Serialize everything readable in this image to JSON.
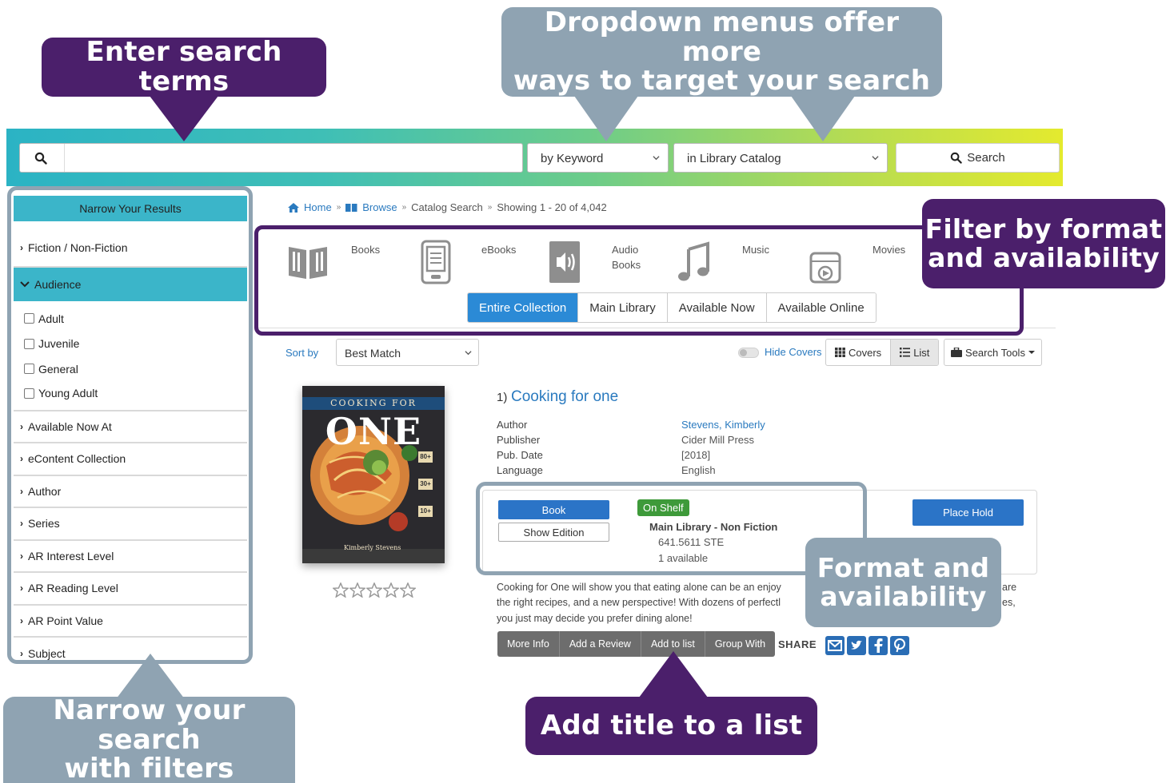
{
  "callouts": {
    "search_terms": "Enter search terms",
    "dropdown_line1": "Dropdown menus offer more",
    "dropdown_line2": "ways to target your search",
    "filter_line1": "Filter by format",
    "filter_line2": "and availability",
    "format_line1": "Format and",
    "format_line2": "availability",
    "narrow_line1": "Narrow your search",
    "narrow_line2": "with filters",
    "add_list": "Add title to a list"
  },
  "search": {
    "value": "",
    "type_select": "by Keyword",
    "scope_select": "in Library Catalog",
    "button_label": "Search"
  },
  "sidebar": {
    "title": "Narrow Your Results",
    "fiction": "Fiction / Non-Fiction",
    "audience": "Audience",
    "audience_options": [
      "Adult",
      "Juvenile",
      "General",
      "Young Adult"
    ],
    "items": [
      "Available Now At",
      "eContent Collection",
      "Author",
      "Series",
      "AR Interest Level",
      "AR Reading Level",
      "AR Point Value",
      "Subject"
    ]
  },
  "breadcrumb": {
    "home": "Home",
    "browse": "Browse",
    "catalog": "Catalog Search",
    "showing": "Showing 1 - 20 of 4,042"
  },
  "formats": {
    "books": "Books",
    "ebooks": "eBooks",
    "audio_line1": "Audio",
    "audio_line2": "Books",
    "music": "Music",
    "movies": "Movies"
  },
  "availability_tabs": [
    "Entire Collection",
    "Main Library",
    "Available Now",
    "Available Online"
  ],
  "sort": {
    "label": "Sort by",
    "value": "Best Match",
    "hide_covers": "Hide Covers",
    "covers": "Covers",
    "list": "List",
    "tools": "Search Tools"
  },
  "result": {
    "number": "1)",
    "title": "Cooking for one",
    "cover_top": "COOKING FOR",
    "cover_big": "ONE",
    "cover_author": "Kimberly Stevens",
    "cover_badges": [
      "80+",
      "30+",
      "10+"
    ],
    "labels": [
      "Author",
      "Publisher",
      "Pub. Date",
      "Language"
    ],
    "author": "Stevens, Kimberly",
    "publisher": "Cider Mill Press",
    "pub_date": "[2018]",
    "language": "English",
    "format_button": "Book",
    "edition_button": "Show Edition",
    "status": "On Shelf",
    "location": "Main Library - Non Fiction",
    "call_number": "641.5611 STE",
    "available": "1 available",
    "place_hold": "Place Hold",
    "desc_line1": "Cooking for One will show you that eating alone can be an enjoy",
    "desc_line1_end": "are",
    "desc_line2": "the right recipes, and a new perspective! With dozens of perfectl",
    "desc_line2_end": "es,",
    "desc_line3": "you just may decide you prefer dining alone!"
  },
  "actions": [
    "More Info",
    "Add a Review",
    "Add to list",
    "Group With"
  ],
  "share_label": "SHARE",
  "colors": {
    "purple_callout": "#4b1f6b",
    "gray_callout": "#8fa3b2",
    "teal_header": "#3bb5c9",
    "primary_button": "#2b74c7",
    "on_shelf": "#3e9a3a"
  }
}
